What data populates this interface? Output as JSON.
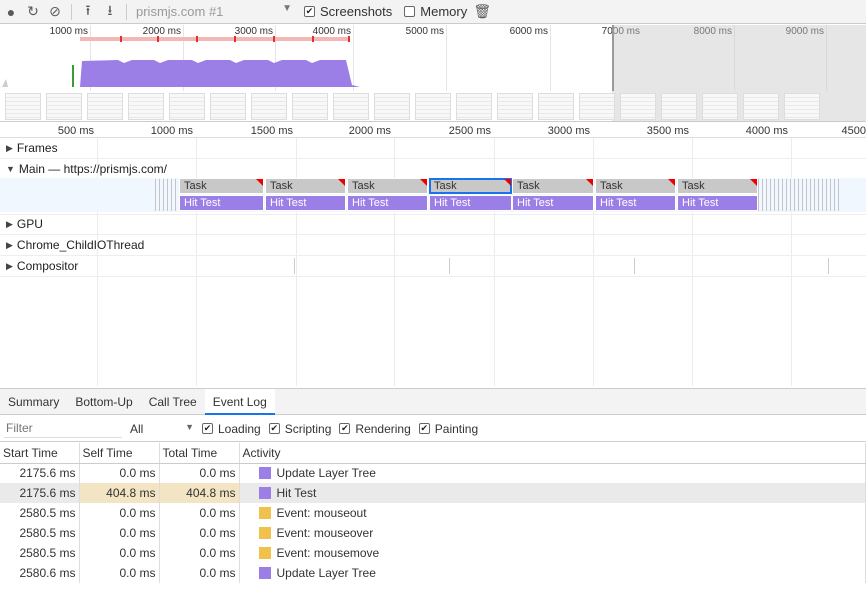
{
  "toolbar": {
    "profile": "prismjs.com #1",
    "screenshots_label": "Screenshots",
    "screenshots_checked": true,
    "memory_label": "Memory",
    "memory_checked": false
  },
  "overview_ticks": [
    "1000 ms",
    "2000 ms",
    "3000 ms",
    "4000 ms",
    "5000 ms",
    "6000 ms",
    "7000 ms",
    "8000 ms",
    "9000 ms"
  ],
  "ruler_ticks": [
    "500 ms",
    "1000 ms",
    "1500 ms",
    "2000 ms",
    "2500 ms",
    "3000 ms",
    "3500 ms",
    "4000 ms",
    "4500"
  ],
  "tracks": {
    "frames": "Frames",
    "main": "Main — https://prismjs.com/",
    "gpu": "GPU",
    "io": "Chrome_ChildIOThread",
    "compositor": "Compositor"
  },
  "task_label": "Task",
  "hit_label": "Hit Test",
  "bottom_tabs": [
    "Summary",
    "Bottom-Up",
    "Call Tree",
    "Event Log"
  ],
  "filter": {
    "placeholder": "Filter",
    "all": "All",
    "loading": "Loading",
    "scripting": "Scripting",
    "rendering": "Rendering",
    "painting": "Painting"
  },
  "table": {
    "headers": [
      "Start Time",
      "Self Time",
      "Total Time",
      "Activity"
    ],
    "rows": [
      {
        "start": "2175.6 ms",
        "self": "0.0 ms",
        "total": "0.0 ms",
        "activity": "Update Layer Tree",
        "color": "#9b7fe6"
      },
      {
        "start": "2175.6 ms",
        "self": "404.8 ms",
        "total": "404.8 ms",
        "activity": "Hit Test",
        "color": "#9b7fe6"
      },
      {
        "start": "2580.5 ms",
        "self": "0.0 ms",
        "total": "0.0 ms",
        "activity": "Event: mouseout",
        "color": "#f0c14b"
      },
      {
        "start": "2580.5 ms",
        "self": "0.0 ms",
        "total": "0.0 ms",
        "activity": "Event: mouseover",
        "color": "#f0c14b"
      },
      {
        "start": "2580.5 ms",
        "self": "0.0 ms",
        "total": "0.0 ms",
        "activity": "Event: mousemove",
        "color": "#f0c14b"
      },
      {
        "start": "2580.6 ms",
        "self": "0.0 ms",
        "total": "0.0 ms",
        "activity": "Update Layer Tree",
        "color": "#9b7fe6"
      }
    ]
  }
}
